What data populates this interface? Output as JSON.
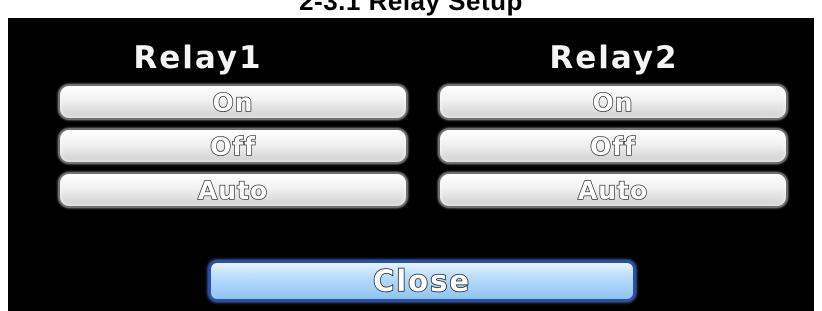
{
  "window": {
    "title": "2-3.1 Relay Setup"
  },
  "relay1": {
    "label": "Relay1",
    "on_label": "On",
    "off_label": "Off",
    "auto_label": "Auto"
  },
  "relay2": {
    "label": "Relay2",
    "on_label": "On",
    "off_label": "Off",
    "auto_label": "Auto"
  },
  "footer": {
    "close_label": "Close"
  },
  "colors": {
    "dialog_background": "#000000",
    "option_button": "#f1f1f1",
    "close_button": "#b8dcfb",
    "close_button_border": "#2b4fa8"
  }
}
